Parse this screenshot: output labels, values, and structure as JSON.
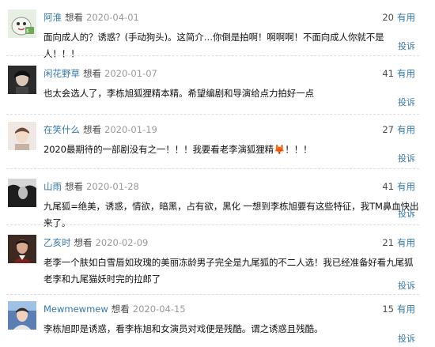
{
  "comments": [
    {
      "username": "阿淮",
      "status": "想看",
      "date": "2020-04-01",
      "votes": "20",
      "useful_label": "有用",
      "content": "面向成人的？诱惑？(手动狗头)。这简介…你倒是拍啊！啊啊啊！不面向成人你就不是人！！！",
      "report_label": "投诉",
      "avatar_icon": "cartoon-ghost-avatar"
    },
    {
      "username": "闲花野草",
      "status": "想看",
      "date": "2020-01-07",
      "votes": "41",
      "useful_label": "有用",
      "content": "也太会选人了，李栋旭狐狸精本精。希望编剧和导演给点力拍好一点",
      "report_label": "投诉",
      "avatar_icon": "dark-portrait-avatar"
    },
    {
      "username": "在笑什么",
      "status": "想看",
      "date": "2020-01-19",
      "votes": "27",
      "useful_label": "有用",
      "content": "2020最期待的一部剧没有之一！！！我要看老李演狐狸精🦊！！！",
      "report_label": "投诉",
      "avatar_icon": "light-portrait-avatar"
    },
    {
      "username": "山雨",
      "status": "想看",
      "date": "2020-01-28",
      "votes": "41",
      "useful_label": "有用",
      "content": "九尾狐=绝美，诱惑，情欲，暗黑，占有欲，黑化 一想到李栋旭要有这些特征，我TM鼻血快出来了。",
      "report_label": "投诉",
      "avatar_icon": "monochrome-portrait-avatar"
    },
    {
      "username": "乙亥时",
      "status": "想看",
      "date": "2020-02-09",
      "votes": "21",
      "useful_label": "有用",
      "content": "老李一个肤如白雪唇如玫瑰的美丽冻龄男子完全是九尾狐的不二人选！我已经准备好看九尾狐老李和九尾猫妖时完的拉郎了",
      "report_label": "投诉",
      "avatar_icon": "painting-portrait-avatar"
    },
    {
      "username": "Mewmewmew",
      "status": "想看",
      "date": "2020-04-15",
      "votes": "15",
      "useful_label": "有用",
      "content": "李栋旭即是诱惑，看李栋旭和女演员对戏便是残酷。谓之诱惑且残酷。",
      "report_label": "投诉",
      "avatar_icon": "colorful-portrait-avatar"
    }
  ],
  "colors": {
    "link": "#3377aa",
    "meta": "#999999",
    "text": "#111111",
    "divider": "#dddddd"
  }
}
